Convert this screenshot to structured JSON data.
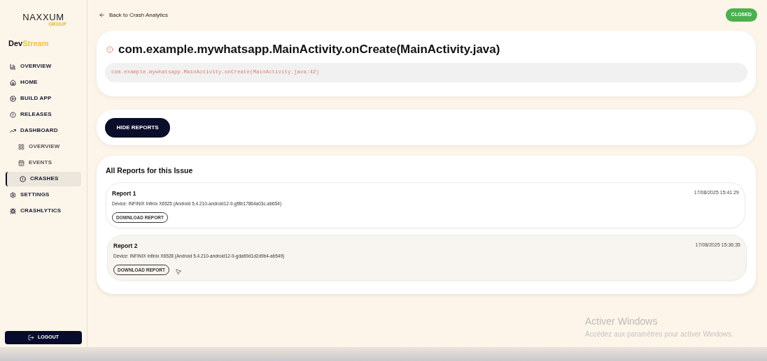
{
  "logo": {
    "name": "NAXXUM",
    "sub": "GROUP"
  },
  "brand": {
    "prefix": "Dev",
    "suffix": "Stream"
  },
  "sidebar": {
    "items": [
      {
        "label": "OVERVIEW",
        "selected": false
      },
      {
        "label": "HOME",
        "selected": false
      },
      {
        "label": "BUILD APP",
        "selected": false
      },
      {
        "label": "RELEASES",
        "selected": false
      },
      {
        "label": "DASHBOARD",
        "selected": false,
        "children": [
          {
            "label": "OVERVIEW",
            "selected": false
          },
          {
            "label": "EVENTS",
            "selected": false
          },
          {
            "label": "CRASHES",
            "selected": true
          }
        ]
      },
      {
        "label": "SETTINGS",
        "selected": false
      },
      {
        "label": "CRASHLYTICS",
        "selected": false
      }
    ],
    "logout": "LOGOUT"
  },
  "back_link": "Back to Crash Analytics",
  "status_badge": "CLOSED",
  "issue": {
    "title": "com.example.mywhatsapp.MainActivity.onCreate(MainActivity.java)",
    "stack_line": "com.example.mywhatsapp.MainActivity.onCreate(MainActivity.java:42)"
  },
  "toggle_button": "HIDE REPORTS",
  "reports": {
    "heading": "All Reports for this Issue",
    "items": [
      {
        "title": "Report 1",
        "timestamp": "17/08/2025 15:41:29",
        "device": "Device: INFINIX Infinix X6525 (Android 5.4.210-android12-9-gf8b17864a03c-ab654)",
        "button": "DOWNLOAD REPORT",
        "highlighted": false
      },
      {
        "title": "Report 2",
        "timestamp": "17/08/2025 15:36:35",
        "device": "Device: INFINIX Infinix X6528 (Android 5.4.210-android12-9-gda69d1d2d9b4-ab549)",
        "button": "DOWNLOAD REPORT",
        "highlighted": true
      }
    ]
  },
  "os_notice": {
    "title": "Activer Windows",
    "text": "Accédez aux paramètres pour activer Windows."
  }
}
